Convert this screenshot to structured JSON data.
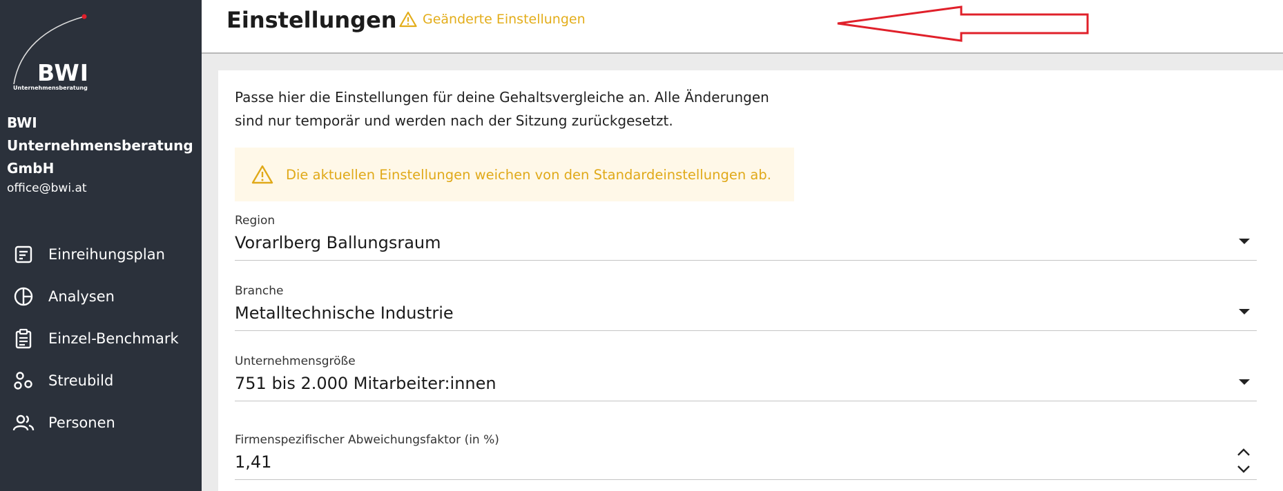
{
  "sidebar": {
    "logo": {
      "text": "BWI",
      "subtext": "Unternehmensberatung"
    },
    "company": {
      "line1": "BWI",
      "line2": "Unternehmensberatung",
      "line3": "GmbH"
    },
    "email": "office@bwi.at",
    "items": [
      {
        "label": "Einreihungsplan",
        "icon": "plan-icon"
      },
      {
        "label": "Analysen",
        "icon": "pie-chart-icon"
      },
      {
        "label": "Einzel-Benchmark",
        "icon": "clipboard-icon"
      },
      {
        "label": "Streubild",
        "icon": "scatter-icon"
      },
      {
        "label": "Personen",
        "icon": "people-icon"
      }
    ]
  },
  "header": {
    "title": "Einstellungen",
    "changed_label": "Geänderte Einstellungen"
  },
  "main": {
    "intro_line1": "Passe hier die Einstellungen für deine Gehaltsvergleiche an. Alle Änderungen",
    "intro_line2": "sind nur temporär und werden nach der Sitzung zurückgesetzt.",
    "alert": "Die aktuellen Einstellungen weichen von den Standardeinstellungen ab.",
    "fields": {
      "region": {
        "label": "Region",
        "value": "Vorarlberg Ballungsraum"
      },
      "branche": {
        "label": "Branche",
        "value": "Metalltechnische Industrie"
      },
      "groesse": {
        "label": "Unternehmensgröße",
        "value": "751 bis 2.000 Mitarbeiter:innen"
      },
      "faktor": {
        "label": "Firmenspezifischer Abweichungsfaktor (in %)",
        "value": "1,41"
      }
    }
  },
  "colors": {
    "sidebar_bg": "#2b313b",
    "warning": "#e3ad1a",
    "alert_bg": "#fff8e8",
    "annotation_arrow": "#e0202a"
  }
}
